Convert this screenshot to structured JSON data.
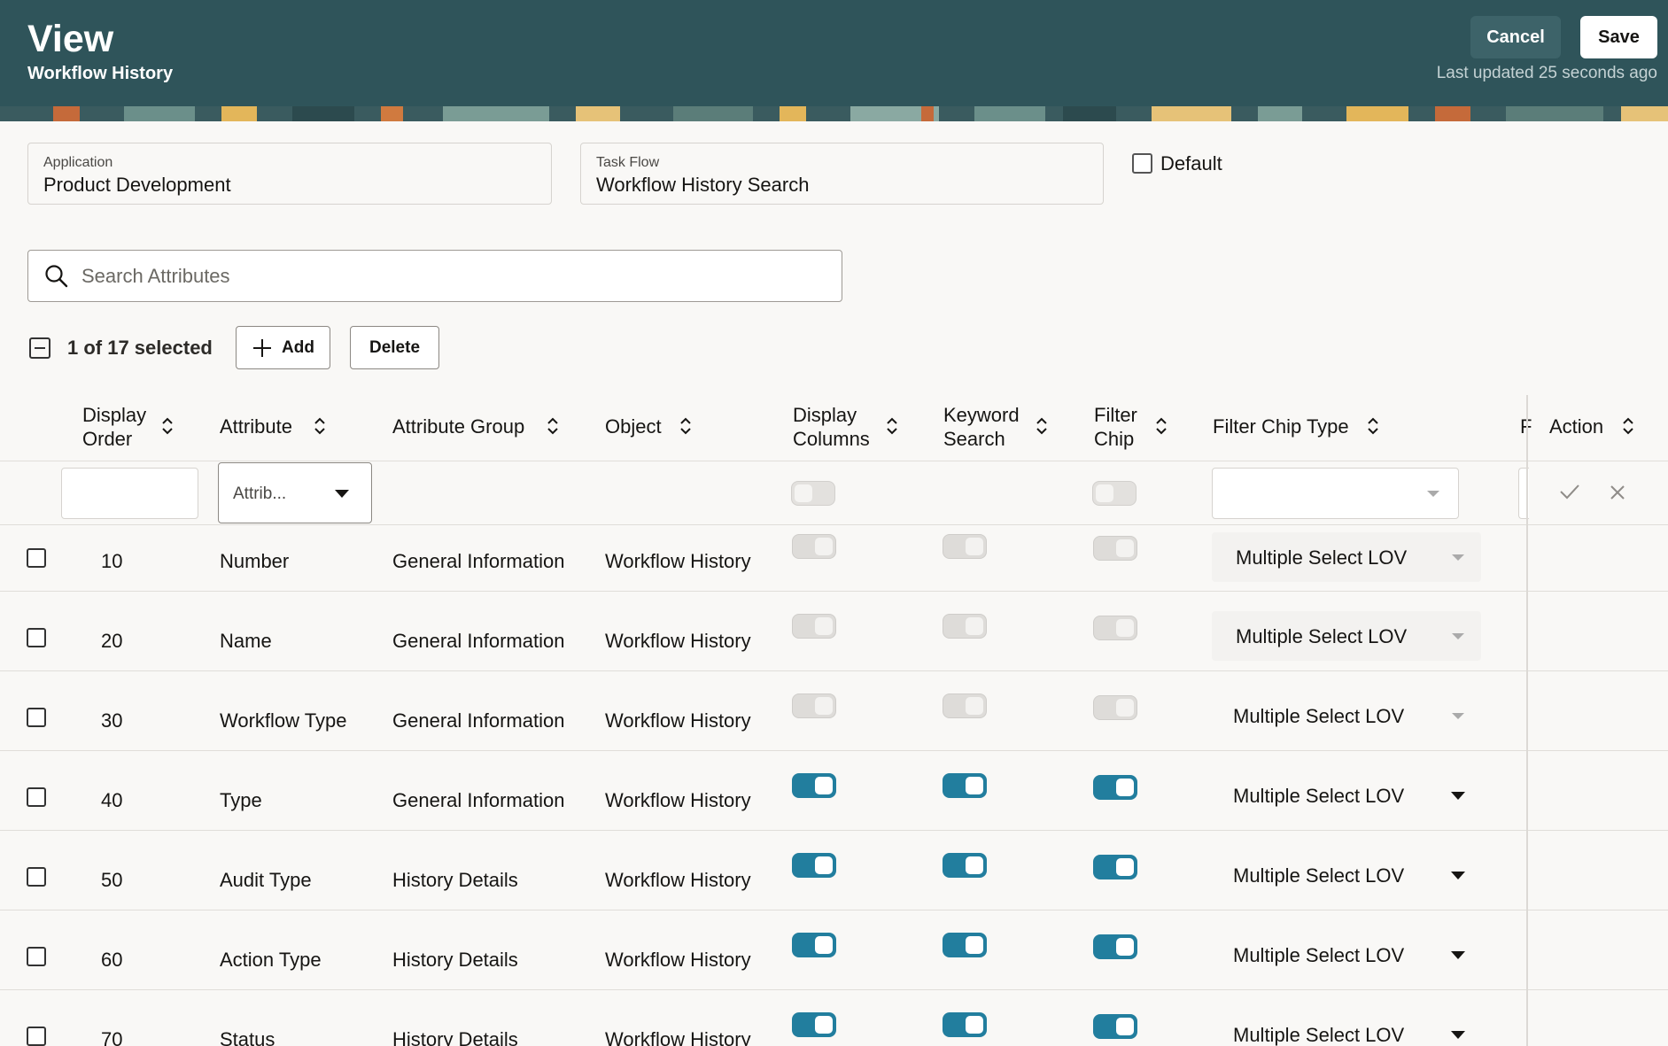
{
  "header": {
    "title": "View",
    "subtitle": "Workflow History",
    "cancel_label": "Cancel",
    "save_label": "Save",
    "last_updated": "Last updated 25 seconds ago"
  },
  "fields": {
    "application": {
      "label": "Application",
      "value": "Product Development"
    },
    "task_flow": {
      "label": "Task Flow",
      "value": "Workflow History Search"
    },
    "default_label": "Default",
    "default_checked": false
  },
  "search": {
    "placeholder": "Search Attributes",
    "value": ""
  },
  "toolbar": {
    "selection_text": "1 of 17 selected",
    "add_label": "Add",
    "delete_label": "Delete"
  },
  "table": {
    "columns": {
      "display_order": [
        "Display",
        "Order"
      ],
      "attribute": "Attribute",
      "attribute_group": "Attribute Group",
      "object": "Object",
      "display_columns": [
        "Display",
        "Columns"
      ],
      "keyword_search": [
        "Keyword",
        "Search"
      ],
      "filter_chip": [
        "Filter",
        "Chip"
      ],
      "filter_chip_type": "Filter Chip Type",
      "truncated": "F",
      "action": "Action"
    },
    "filters": {
      "display_order": "",
      "attribute_placeholder": "Attrib...",
      "filter_chip_type": ""
    },
    "rows": [
      {
        "order": "10",
        "attribute": "Number",
        "group": "General Information",
        "object": "Workflow History",
        "display_columns": "disabled",
        "keyword_search": "disabled",
        "filter_chip": "disabled",
        "chip_type": "Multiple Select LOV"
      },
      {
        "order": "20",
        "attribute": "Name",
        "group": "General Information",
        "object": "Workflow History",
        "display_columns": "disabled",
        "keyword_search": "disabled",
        "filter_chip": "disabled",
        "chip_type": "Multiple Select LOV"
      },
      {
        "order": "30",
        "attribute": "Workflow Type",
        "group": "General Information",
        "object": "Workflow History",
        "display_columns": "disabled",
        "keyword_search": "disabled",
        "filter_chip": "disabled",
        "chip_type": "Multiple Select LOV"
      },
      {
        "order": "40",
        "attribute": "Type",
        "group": "General Information",
        "object": "Workflow History",
        "display_columns": "on",
        "keyword_search": "on",
        "filter_chip": "on",
        "chip_type": "Multiple Select LOV"
      },
      {
        "order": "50",
        "attribute": "Audit Type",
        "group": "History Details",
        "object": "Workflow History",
        "display_columns": "on",
        "keyword_search": "on",
        "filter_chip": "on",
        "chip_type": "Multiple Select LOV"
      },
      {
        "order": "60",
        "attribute": "Action Type",
        "group": "History Details",
        "object": "Workflow History",
        "display_columns": "on",
        "keyword_search": "on",
        "filter_chip": "on",
        "chip_type": "Multiple Select LOV"
      },
      {
        "order": "70",
        "attribute": "Status",
        "group": "History Details",
        "object": "Workflow History",
        "display_columns": "on",
        "keyword_search": "on",
        "filter_chip": "on",
        "chip_type": "Multiple Select LOV"
      }
    ]
  },
  "colors": {
    "header_bg": "#2f545a",
    "toggle_on": "#227e9e",
    "toggle_off": "#dedcd9"
  },
  "icons": [
    "search-icon",
    "plus-icon",
    "sort-icon",
    "chevron-down-icon",
    "check-icon",
    "close-icon"
  ]
}
